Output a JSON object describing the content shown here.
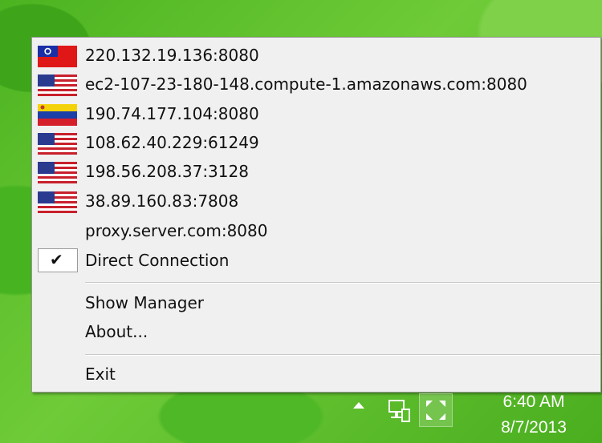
{
  "menu": {
    "proxies": [
      {
        "label": "220.132.19.136:8080",
        "flag": "taiwan-flag"
      },
      {
        "label": "ec2-107-23-180-148.compute-1.amazonaws.com:8080",
        "flag": "us-flag"
      },
      {
        "label": "190.74.177.104:8080",
        "flag": "venezuela-flag"
      },
      {
        "label": "108.62.40.229:61249",
        "flag": "us-flag"
      },
      {
        "label": "198.56.208.37:3128",
        "flag": "us-flag"
      },
      {
        "label": "38.89.160.83:7808",
        "flag": "us-flag"
      }
    ],
    "custom_proxy": "proxy.server.com:8080",
    "direct_connection": "Direct Connection",
    "direct_checked": true,
    "show_manager": "Show Manager",
    "about": "About...",
    "exit": "Exit"
  },
  "taskbar": {
    "time": "6:40 AM",
    "date": "8/7/2013",
    "icons": [
      "tray-overflow-arrow-icon",
      "network-icon",
      "proxy-switcher-icon"
    ]
  }
}
